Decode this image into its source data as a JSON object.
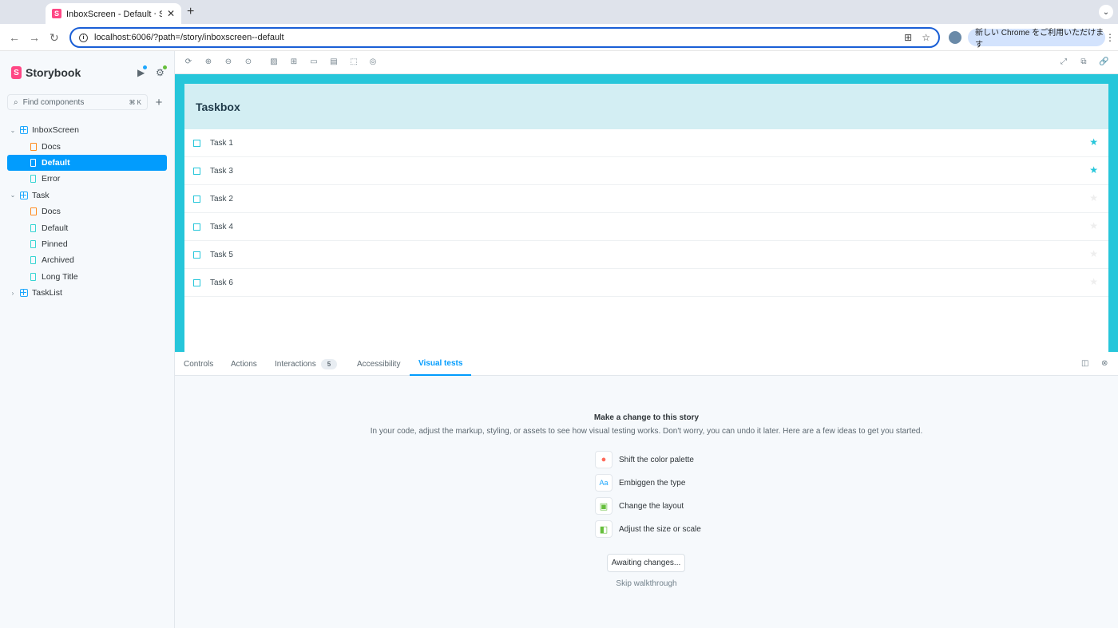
{
  "browser": {
    "tab_title": "InboxScreen - Default ⋅ Story",
    "url": "localhost:6006/?path=/story/inboxscreen--default",
    "promo": "新しい Chrome をご利用いただけます"
  },
  "sidebar": {
    "brand": "Storybook",
    "search_placeholder": "Find components",
    "search_shortcut": "⌘ K",
    "tree": [
      {
        "label": "InboxScreen",
        "kind": "component",
        "expanded": true
      },
      {
        "label": "Docs",
        "kind": "docs"
      },
      {
        "label": "Default",
        "kind": "story",
        "selected": true
      },
      {
        "label": "Error",
        "kind": "story"
      },
      {
        "label": "Task",
        "kind": "component",
        "expanded": true
      },
      {
        "label": "Docs",
        "kind": "docs"
      },
      {
        "label": "Default",
        "kind": "story"
      },
      {
        "label": "Pinned",
        "kind": "story"
      },
      {
        "label": "Archived",
        "kind": "story"
      },
      {
        "label": "Long Title",
        "kind": "story"
      },
      {
        "label": "TaskList",
        "kind": "component",
        "expanded": false
      }
    ]
  },
  "preview": {
    "header": "Taskbox",
    "tasks": [
      {
        "title": "Task 1",
        "pinned": true
      },
      {
        "title": "Task 3",
        "pinned": true
      },
      {
        "title": "Task 2",
        "pinned": false
      },
      {
        "title": "Task 4",
        "pinned": false
      },
      {
        "title": "Task 5",
        "pinned": false
      },
      {
        "title": "Task 6",
        "pinned": false
      }
    ]
  },
  "panel": {
    "tabs": {
      "controls": "Controls",
      "actions": "Actions",
      "interactions": "Interactions",
      "interactions_count": "5",
      "accessibility": "Accessibility",
      "visual_tests": "Visual tests"
    },
    "title": "Make a change to this story",
    "description": "In your code, adjust the markup, styling, or assets to see how visual testing works. Don't worry, you can undo it later. Here are a few ideas to get you started.",
    "ideas": [
      {
        "label": "Shift the color palette",
        "icon": "palette-icon"
      },
      {
        "label": "Embiggen the type",
        "icon": "type-icon"
      },
      {
        "label": "Change the layout",
        "icon": "layout-icon"
      },
      {
        "label": "Adjust the size or scale",
        "icon": "scale-icon"
      }
    ],
    "awaiting_button": "Awaiting changes...",
    "skip_link": "Skip walkthrough"
  },
  "colors": {
    "accent": "#029cfd",
    "canvas": "#26c6da",
    "brand": "#ff4785"
  }
}
